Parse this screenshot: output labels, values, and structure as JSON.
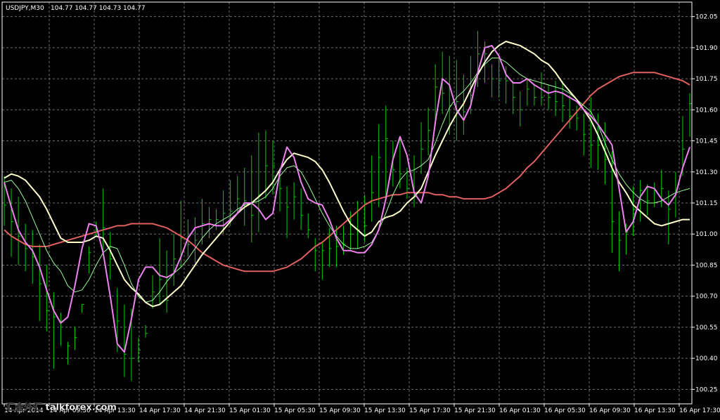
{
  "header": {
    "symbol_timeframe": "USDJPY,M30",
    "ohlc": "104.77 104.77 104.73 104.77"
  },
  "watermark": "汇金外汇 talkforex.com",
  "colors": {
    "background": "#000000",
    "grid": "#6e6e6e",
    "bars": "#00cc00",
    "price_line": "#ee82ee",
    "ma_fast": "#ffffcc",
    "ma_signal": "#98fb98",
    "ma_slow": "#e06060",
    "axis_text": "#ffffff"
  },
  "chart_data": {
    "type": "line",
    "grid": true,
    "ylim": [
      100.18,
      102.12
    ],
    "y_ticks": [
      "102.05",
      "101.90",
      "101.75",
      "101.60",
      "101.45",
      "101.30",
      "101.15",
      "101.00",
      "100.85",
      "100.70",
      "100.55",
      "100.40",
      "100.25"
    ],
    "x_ticks": [
      "14 Apr 2014",
      "14 Apr 09:30",
      "14 Apr 13:30",
      "14 Apr 17:30",
      "14 Apr 21:30",
      "15 Apr 01:30",
      "15 Apr 05:30",
      "15 Apr 09:30",
      "15 Apr 13:30",
      "15 Apr 17:30",
      "15 Apr 21:30",
      "16 Apr 01:30",
      "16 Apr 05:30",
      "16 Apr 09:30",
      "16 Apr 13:30",
      "16 Apr 17:30"
    ],
    "n_bars": 98,
    "bars": {
      "name": "",
      "high": [
        101.28,
        101.22,
        101.18,
        101.05,
        101.02,
        100.95,
        100.85,
        100.72,
        100.62,
        100.48,
        100.55,
        100.66,
        100.94,
        101.06,
        101.22,
        101.01,
        100.74,
        100.66,
        100.64,
        100.5,
        100.56,
        100.8,
        100.98,
        100.92,
        101.0,
        101.16,
        101.07,
        101.08,
        101.17,
        101.13,
        101.12,
        101.21,
        101.26,
        101.28,
        101.32,
        101.38,
        101.49,
        101.5,
        101.45,
        101.32,
        101.23,
        101.25,
        101.22,
        101.1,
        100.98,
        100.96,
        101.03,
        101.04,
        101.04,
        101.11,
        101.16,
        101.19,
        101.38,
        101.53,
        101.62,
        101.45,
        101.46,
        101.32,
        101.38,
        101.54,
        101.61,
        101.82,
        101.88,
        101.86,
        101.84,
        101.77,
        101.86,
        101.98,
        101.93,
        101.82,
        101.86,
        101.81,
        101.74,
        101.69,
        101.75,
        101.72,
        101.78,
        101.72,
        101.74,
        101.74,
        101.67,
        101.62,
        101.58,
        101.66,
        101.58,
        101.54,
        101.4,
        101.11,
        101.05,
        101.23,
        101.26,
        101.24,
        101.25,
        101.31,
        101.21,
        101.3,
        101.57,
        101.68
      ],
      "low": [
        101.04,
        100.89,
        100.85,
        100.82,
        100.76,
        100.58,
        100.53,
        100.35,
        100.46,
        100.37,
        100.44,
        100.62,
        100.81,
        100.99,
        100.9,
        100.78,
        100.43,
        100.31,
        100.29,
        100.38,
        100.5,
        100.64,
        100.66,
        100.62,
        100.75,
        100.84,
        100.89,
        100.86,
        100.95,
        100.98,
        101.02,
        101.0,
        101.04,
        101.1,
        101.04,
        100.96,
        101.01,
        101.17,
        101.19,
        101.11,
        100.98,
        101.07,
        101.02,
        100.98,
        100.82,
        100.78,
        100.84,
        100.84,
        100.9,
        100.92,
        100.93,
        100.96,
        101.06,
        101.13,
        101.18,
        101.23,
        101.22,
        101.17,
        101.13,
        101.29,
        101.38,
        101.52,
        101.58,
        101.48,
        101.45,
        101.48,
        101.58,
        101.71,
        101.73,
        101.66,
        101.66,
        101.63,
        101.58,
        101.52,
        101.62,
        101.62,
        101.62,
        101.6,
        101.57,
        101.54,
        101.51,
        101.5,
        101.38,
        101.32,
        101.31,
        101.24,
        100.91,
        100.82,
        100.9,
        100.99,
        101.06,
        101.09,
        101.13,
        101.13,
        100.95,
        101.08,
        101.28,
        101.47
      ],
      "close": [
        101.14,
        101.06,
        100.99,
        100.93,
        100.89,
        100.76,
        100.63,
        100.6,
        100.58,
        100.46,
        100.5,
        100.66,
        100.91,
        101.02,
        101.03,
        100.88,
        100.58,
        100.42,
        100.4,
        100.44,
        100.52,
        100.72,
        100.78,
        100.68,
        100.88,
        100.98,
        100.95,
        100.97,
        101.05,
        101.07,
        101.07,
        101.1,
        101.11,
        101.17,
        101.16,
        101.09,
        101.19,
        101.33,
        101.33,
        101.22,
        101.13,
        101.18,
        101.09,
        101.02,
        100.92,
        100.92,
        100.93,
        100.94,
        100.95,
        101.0,
        101.02,
        101.04,
        101.2,
        101.37,
        101.46,
        101.31,
        101.29,
        101.22,
        101.18,
        101.41,
        101.5,
        101.71,
        101.68,
        101.62,
        101.64,
        101.59,
        101.67,
        101.87,
        101.87,
        101.75,
        101.74,
        101.74,
        101.66,
        101.6,
        101.7,
        101.66,
        101.66,
        101.66,
        101.64,
        101.62,
        101.57,
        101.56,
        101.48,
        101.43,
        101.43,
        101.36,
        101.06,
        100.97,
        101.01,
        101.12,
        101.21,
        101.16,
        101.21,
        101.22,
        101.12,
        101.2,
        101.41,
        101.63
      ]
    },
    "series": [
      {
        "name": "",
        "color": "price_line",
        "values": [
          101.25,
          101.13,
          101.02,
          100.96,
          100.92,
          100.84,
          100.73,
          100.63,
          100.57,
          100.6,
          100.75,
          100.93,
          101.05,
          101.04,
          100.91,
          100.7,
          100.47,
          100.43,
          100.59,
          100.78,
          100.84,
          100.84,
          100.8,
          100.79,
          100.81,
          100.89,
          100.98,
          101.03,
          101.04,
          101.05,
          101.04,
          101.04,
          101.07,
          101.1,
          101.15,
          101.15,
          101.12,
          101.07,
          101.1,
          101.3,
          101.42,
          101.37,
          101.25,
          101.17,
          101.15,
          101.14,
          101.07,
          100.98,
          100.92,
          100.92,
          100.91,
          100.91,
          100.95,
          101.02,
          101.17,
          101.36,
          101.47,
          101.38,
          101.2,
          101.15,
          101.28,
          101.54,
          101.75,
          101.72,
          101.6,
          101.55,
          101.62,
          101.78,
          101.9,
          101.91,
          101.86,
          101.77,
          101.73,
          101.73,
          101.75,
          101.72,
          101.7,
          101.68,
          101.69,
          101.68,
          101.66,
          101.64,
          101.6,
          101.57,
          101.53,
          101.48,
          101.43,
          101.22,
          101.01,
          101.06,
          101.18,
          101.23,
          101.22,
          101.17,
          101.14,
          101.19,
          101.32,
          101.42
        ]
      },
      {
        "name": "",
        "color": "ma_fast",
        "values": [
          101.27,
          101.29,
          101.28,
          101.26,
          101.22,
          101.18,
          101.12,
          101.05,
          100.98,
          100.96,
          100.96,
          100.96,
          100.97,
          100.99,
          100.98,
          100.92,
          100.85,
          100.78,
          100.74,
          100.71,
          100.67,
          100.65,
          100.66,
          100.69,
          100.72,
          100.75,
          100.8,
          100.85,
          100.9,
          100.94,
          100.98,
          101.02,
          101.06,
          101.1,
          101.13,
          101.15,
          101.18,
          101.21,
          101.25,
          101.31,
          101.36,
          101.39,
          101.38,
          101.37,
          101.35,
          101.31,
          101.25,
          101.18,
          101.11,
          101.05,
          101.02,
          100.99,
          101.01,
          101.06,
          101.08,
          101.09,
          101.11,
          101.15,
          101.18,
          101.22,
          101.3,
          101.38,
          101.45,
          101.52,
          101.58,
          101.63,
          101.7,
          101.77,
          101.83,
          101.88,
          101.91,
          101.93,
          101.92,
          101.91,
          101.89,
          101.87,
          101.84,
          101.82,
          101.78,
          101.73,
          101.69,
          101.65,
          101.6,
          101.55,
          101.48,
          101.4,
          101.32,
          101.25,
          101.2,
          101.14,
          101.11,
          101.08,
          101.05,
          101.04,
          101.05,
          101.06,
          101.07,
          101.07
        ]
      },
      {
        "name": "",
        "color": "ma_signal",
        "values": [
          101.25,
          101.26,
          101.22,
          101.16,
          101.08,
          101.0,
          100.92,
          100.86,
          100.82,
          100.75,
          100.72,
          100.73,
          100.78,
          100.85,
          100.91,
          100.94,
          100.93,
          100.85,
          100.76,
          100.7,
          100.67,
          100.68,
          100.72,
          100.77,
          100.81,
          100.84,
          100.88,
          100.93,
          100.98,
          101.02,
          101.05,
          101.07,
          101.09,
          101.12,
          101.14,
          101.15,
          101.16,
          101.18,
          101.22,
          101.28,
          101.32,
          101.33,
          101.3,
          101.24,
          101.17,
          101.1,
          101.04,
          100.99,
          100.95,
          100.93,
          100.93,
          100.94,
          100.96,
          101.02,
          101.1,
          101.19,
          101.26,
          101.3,
          101.31,
          101.33,
          101.36,
          101.44,
          101.53,
          101.61,
          101.66,
          101.69,
          101.73,
          101.78,
          101.82,
          101.85,
          101.85,
          101.83,
          101.8,
          101.77,
          101.75,
          101.74,
          101.73,
          101.72,
          101.71,
          101.7,
          101.68,
          101.65,
          101.62,
          101.59,
          101.53,
          101.44,
          101.36,
          101.29,
          101.24,
          101.2,
          101.17,
          101.15,
          101.15,
          101.16,
          101.18,
          101.2,
          101.21,
          101.22
        ]
      },
      {
        "name": "",
        "color": "ma_slow",
        "values": [
          101.02,
          100.99,
          100.97,
          100.95,
          100.94,
          100.94,
          100.94,
          100.95,
          100.96,
          100.97,
          100.98,
          100.99,
          101.0,
          101.01,
          101.02,
          101.03,
          101.04,
          101.04,
          101.05,
          101.05,
          101.05,
          101.05,
          101.04,
          101.03,
          101.01,
          100.99,
          100.97,
          100.94,
          100.91,
          100.89,
          100.87,
          100.85,
          100.84,
          100.83,
          100.82,
          100.82,
          100.82,
          100.82,
          100.82,
          100.83,
          100.84,
          100.86,
          100.88,
          100.91,
          100.94,
          100.96,
          100.99,
          101.02,
          101.05,
          101.08,
          101.11,
          101.14,
          101.16,
          101.17,
          101.18,
          101.19,
          101.19,
          101.2,
          101.2,
          101.2,
          101.2,
          101.19,
          101.19,
          101.18,
          101.18,
          101.17,
          101.17,
          101.17,
          101.17,
          101.18,
          101.2,
          101.22,
          101.25,
          101.28,
          101.32,
          101.35,
          101.39,
          101.43,
          101.47,
          101.51,
          101.55,
          101.59,
          101.63,
          101.67,
          101.7,
          101.72,
          101.74,
          101.76,
          101.77,
          101.78,
          101.78,
          101.78,
          101.78,
          101.77,
          101.76,
          101.75,
          101.74,
          101.72
        ]
      }
    ]
  }
}
